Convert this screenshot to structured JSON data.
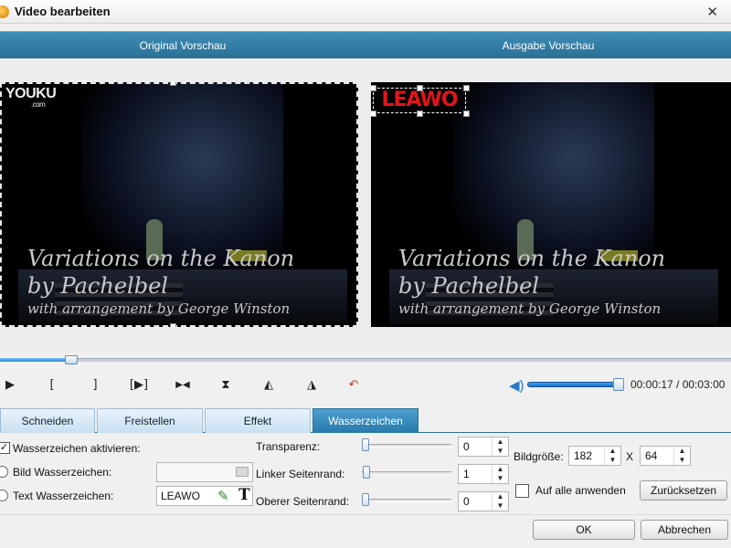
{
  "window": {
    "title": "Video bearbeiten",
    "close_glyph": "✕"
  },
  "preview": {
    "original_header": "Original Vorschau",
    "output_header": "Ausgabe Vorschau",
    "source_logo": "YOUKU",
    "source_logo_sub": ".com",
    "caption_line1": "Variations on the Kanon",
    "caption_line2": "by Pachelbel",
    "caption_line3": "with arrangement by George Winston",
    "watermark_text": "LEAWO",
    "watermark_color": "#e4141b"
  },
  "playback": {
    "seek_fraction": 0.09,
    "volume_fraction": 1.0,
    "time": "00:00:17 / 00:03:00",
    "buttons": [
      {
        "name": "play-icon",
        "glyph": "▶"
      },
      {
        "name": "mark-in-icon",
        "glyph": "["
      },
      {
        "name": "mark-out-icon",
        "glyph": "]"
      },
      {
        "name": "play-selection-icon",
        "glyph": "[▶]"
      },
      {
        "name": "step-frame-icon",
        "glyph": "▶◀"
      },
      {
        "name": "flip-vertical-icon",
        "glyph": "⧗"
      },
      {
        "name": "rotate-left-icon",
        "glyph": "◭"
      },
      {
        "name": "rotate-right-icon",
        "glyph": "◮"
      },
      {
        "name": "undo-icon",
        "glyph": "↶"
      }
    ],
    "volume_icon": "speaker-icon"
  },
  "tabs": [
    {
      "label": "Schneiden",
      "active": false
    },
    {
      "label": "Freistellen",
      "active": false
    },
    {
      "label": "Effekt",
      "active": false
    },
    {
      "label": "Wasserzeichen",
      "active": true
    }
  ],
  "watermark_panel": {
    "enable_label": "Wasserzeichen aktivieren:",
    "enable_checked": true,
    "image_label": "Bild Wasserzeichen:",
    "image_value": "",
    "text_label": "Text Wasserzeichen:",
    "text_value": "LEAWO",
    "transparency_label": "Transparenz:",
    "transparency_value": "0",
    "left_margin_label": "Linker Seitenrand:",
    "left_margin_value": "1",
    "top_margin_label": "Oberer Seitenrand:",
    "top_margin_value": "0",
    "size_label": "Bildgröße:",
    "size_width": "182",
    "size_sep": "X",
    "size_height": "64",
    "apply_all_label": "Auf alle anwenden",
    "reset_label": "Zurücksetzen"
  },
  "footer": {
    "ok_label": "OK",
    "cancel_label": "Abbrechen"
  }
}
